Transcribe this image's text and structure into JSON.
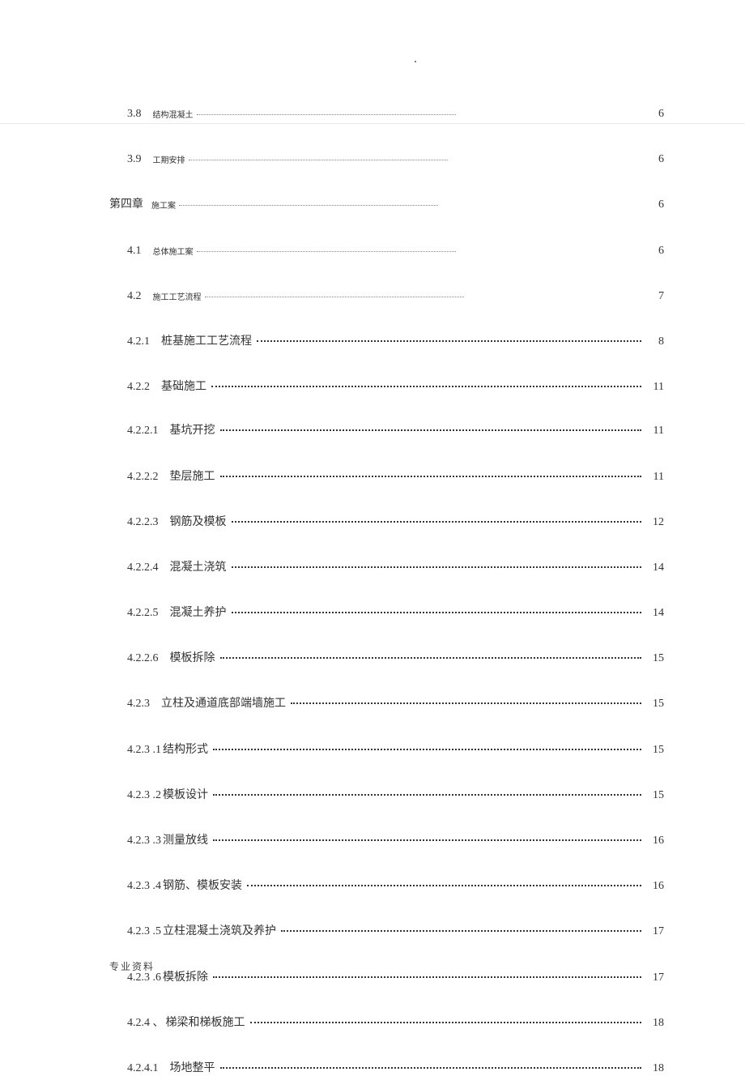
{
  "toc": [
    {
      "num": "3.8",
      "title": "结构混凝土",
      "page": "6",
      "style": "special",
      "indent": 1,
      "titleSmall": true
    },
    {
      "num": "3.9",
      "title": "工期安排",
      "page": "6",
      "style": "special",
      "indent": 1,
      "titleSmall": true
    },
    {
      "num": "第四章",
      "title": "施工案",
      "page": "6",
      "style": "special",
      "indent": 0,
      "titleSmall": true,
      "chapter": true
    },
    {
      "num": "4.1",
      "title": "总体施工案",
      "page": "6",
      "style": "special",
      "indent": 1,
      "titleSmall": true
    },
    {
      "num": "4.2",
      "title": "施工工艺流程",
      "page": "7",
      "style": "special",
      "indent": 1,
      "titleSmall": true
    },
    {
      "num": "4.2.1",
      "title": "桩基施工工艺流程",
      "page": "8",
      "style": "wide",
      "indent": 1
    },
    {
      "num": "4.2.2",
      "title": "基础施工",
      "page": "11",
      "style": "wide",
      "indent": 1,
      "tight": true
    },
    {
      "num": "4.2.2.1",
      "title": "基坑开挖",
      "page": "11",
      "style": "wide",
      "indent": 1
    },
    {
      "num": "4.2.2.2",
      "title": "垫层施工",
      "page": "11",
      "style": "wide",
      "indent": 1
    },
    {
      "num": "4.2.2.3",
      "title": "钢筋及模板",
      "page": "12",
      "style": "wide",
      "indent": 1
    },
    {
      "num": "4.2.2.4",
      "title": "混凝土浇筑",
      "page": "14",
      "style": "wide",
      "indent": 1
    },
    {
      "num": "4.2.2.5",
      "title": "混凝土养护",
      "page": "14",
      "style": "wide",
      "indent": 1
    },
    {
      "num": "4.2.2.6",
      "title": "模板拆除",
      "page": "15",
      "style": "wide",
      "indent": 1
    },
    {
      "num": "4.2.3",
      "title": "立柱及通道底部端墙施工",
      "page": "15",
      "style": "wide",
      "indent": 1
    },
    {
      "num": "4.2.3  .1",
      "title": "结构形式",
      "page": "15",
      "style": "wide",
      "indent": 1,
      "joined": true
    },
    {
      "num": "4.2.3  .2",
      "title": "模板设计",
      "page": "15",
      "style": "wide",
      "indent": 1,
      "joined": true
    },
    {
      "num": "4.2.3  .3",
      "title": "测量放线",
      "page": "16",
      "style": "wide",
      "indent": 1,
      "joined": true
    },
    {
      "num": "4.2.3  .4",
      "title": "钢筋、模板安装",
      "page": "16",
      "style": "wide",
      "indent": 1,
      "joined": true
    },
    {
      "num": "4.2.3  .5",
      "title": "立柱混凝土浇筑及养护",
      "page": "17",
      "style": "wide",
      "indent": 1,
      "joined": true
    },
    {
      "num": "4.2.3  .6",
      "title": "模板拆除",
      "page": "17",
      "style": "wide",
      "indent": 1,
      "joined": true
    },
    {
      "num": "4.2.4 、",
      "title": "梯梁和梯板施工",
      "page": "18",
      "style": "wide",
      "indent": 1,
      "joined": true
    },
    {
      "num": "4.2.4.1",
      "title": "场地整平",
      "page": "18",
      "style": "wide",
      "indent": 1
    }
  ],
  "footer": "专业资料"
}
